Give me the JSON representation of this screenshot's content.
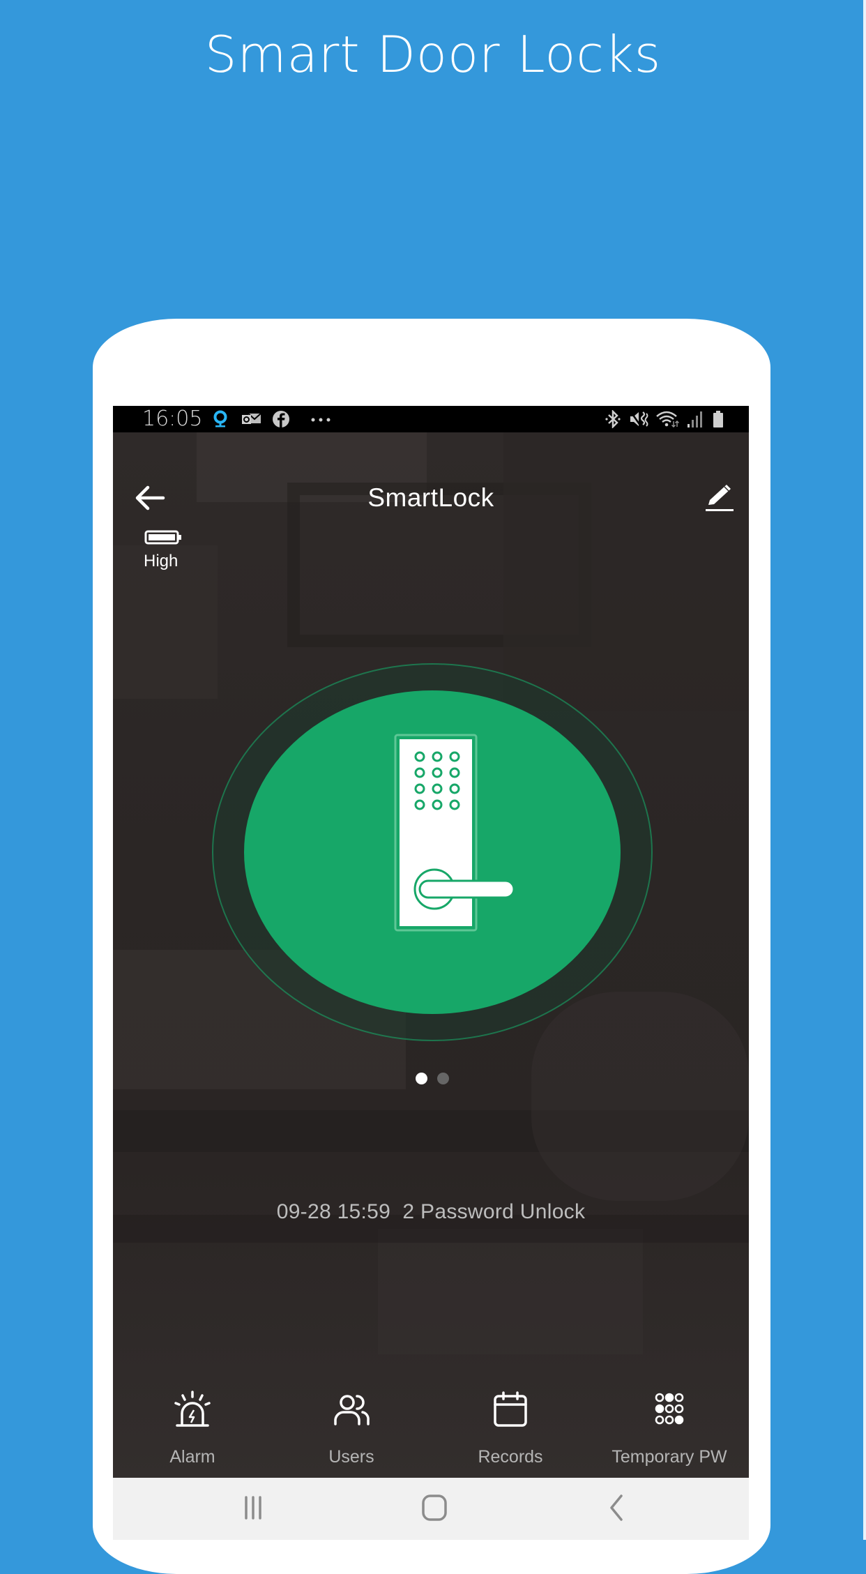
{
  "promo": {
    "title": "Smart Door Locks"
  },
  "colors": {
    "background": "#3498db",
    "accent_green": "#17a768",
    "alexa_cyan": "#29b6f6",
    "label_grey": "#bdbdbd",
    "navbar": "#f1f1f1"
  },
  "statusbar": {
    "time": "16:05",
    "left_icons": [
      "alexa-icon",
      "outlook-icon",
      "facebook-icon",
      "more-notifications-icon"
    ],
    "right_icons": [
      "bluetooth-icon",
      "vibrate-icon",
      "wifi-icon",
      "signal-icon",
      "battery-icon"
    ]
  },
  "header": {
    "title": "SmartLock",
    "back_icon": "arrow-left-icon",
    "edit_icon": "pencil-icon"
  },
  "battery": {
    "label": "High",
    "icon": "battery-full-icon"
  },
  "lock": {
    "icon": "keypad-door-lock-icon",
    "state": "unlocked"
  },
  "pager": {
    "pages": 2,
    "active_index": 0
  },
  "last_record": {
    "text": "09-28 15:59  2 Password Unlock"
  },
  "menu": [
    {
      "label": "Alarm",
      "icon": "alarm-siren-icon"
    },
    {
      "label": "Users",
      "icon": "users-icon"
    },
    {
      "label": "Records",
      "icon": "calendar-icon"
    },
    {
      "label": "Temporary PW",
      "icon": "keypad-icon"
    }
  ],
  "navbar": {
    "buttons": [
      {
        "name": "recents",
        "icon": "recents-icon"
      },
      {
        "name": "home",
        "icon": "home-icon"
      },
      {
        "name": "back",
        "icon": "back-chevron-icon"
      }
    ]
  }
}
